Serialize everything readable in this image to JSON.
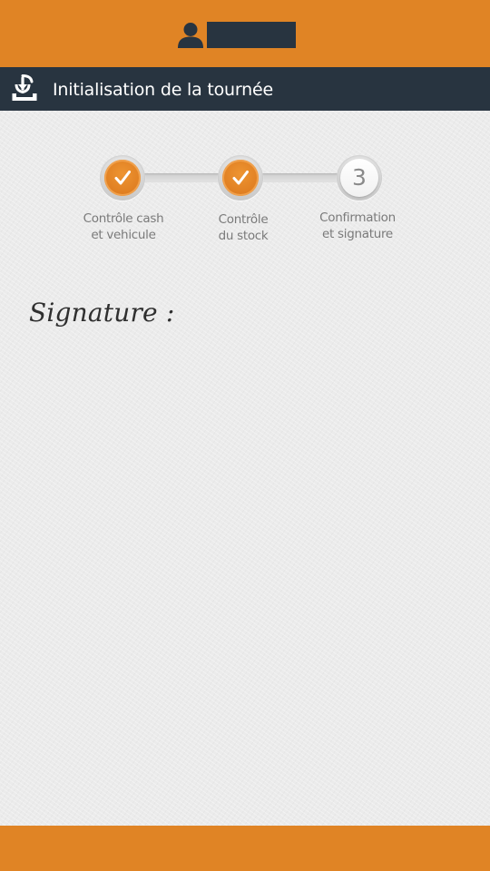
{
  "colors": {
    "header_orange": "#e08425",
    "title_bar_navy": "#283440",
    "step_done_orange": "#e2801f",
    "background_gray": "#ebebeb"
  },
  "header": {
    "user_icon": "user-silhouette-icon",
    "user_name": ""
  },
  "title_bar": {
    "icon": "download-tray-icon",
    "title": "Initialisation de la tournée"
  },
  "stepper": {
    "steps": [
      {
        "status": "done",
        "icon": "check-icon",
        "number": "",
        "label_line1": "Contrôle cash",
        "label_line2": "et vehicule"
      },
      {
        "status": "done",
        "icon": "check-icon",
        "number": "",
        "label_line1": "Contrôle",
        "label_line2": "du stock"
      },
      {
        "status": "current",
        "icon": "",
        "number": "3",
        "label_line1": "Confirmation",
        "label_line2": "et signature"
      }
    ]
  },
  "signature": {
    "label": "Signature :"
  }
}
